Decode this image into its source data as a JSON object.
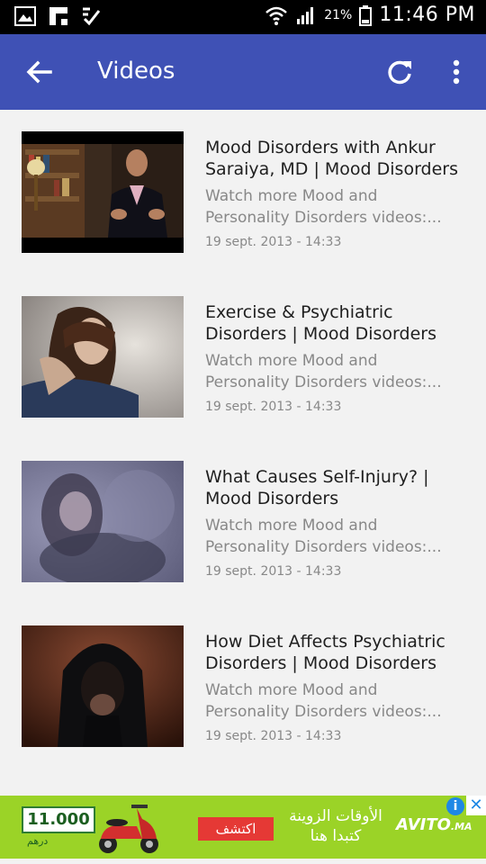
{
  "status_bar": {
    "battery_pct": "21%",
    "time": "11:46 PM"
  },
  "app_bar": {
    "title": "Videos"
  },
  "videos": [
    {
      "title": "Mood Disorders with Ankur Saraiya, MD | Mood Disorders",
      "desc_line1": "Watch more Mood and",
      "desc_line2": "Personality Disorders videos:...",
      "date": "19 sept. 2013 - 14:33"
    },
    {
      "title": "Exercise & Psychiatric Disorders | Mood Disorders",
      "desc_line1": "Watch more Mood and",
      "desc_line2": "Personality Disorders videos:...",
      "date": "19 sept. 2013 - 14:33"
    },
    {
      "title": "What Causes Self-Injury? | Mood Disorders",
      "desc_line1": "Watch more Mood and",
      "desc_line2": "Personality Disorders videos:...",
      "date": "19 sept. 2013 - 14:33"
    },
    {
      "title": "How Diet Affects Psychiatric Disorders | Mood Disorders",
      "desc_line1": "Watch more Mood and",
      "desc_line2": "Personality Disorders videos:...",
      "date": "19 sept. 2013 - 14:33"
    }
  ],
  "ad": {
    "price": "11.000",
    "currency": "درهم",
    "cta": "اكتشف",
    "tagline": "الأوقات الزوينة كتبدا هنا",
    "brand": "AVITO",
    "brand_suffix": ".MA",
    "info_label": "i",
    "close_label": "✕"
  }
}
